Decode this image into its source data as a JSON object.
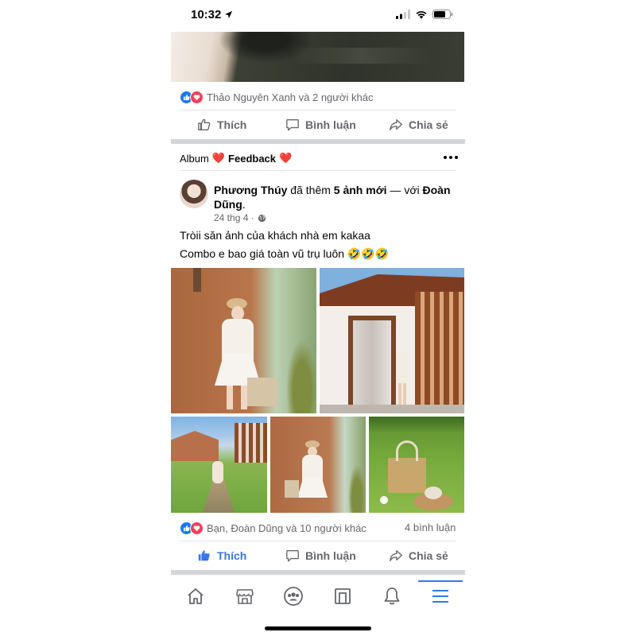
{
  "status_bar": {
    "time": "10:32"
  },
  "post1": {
    "reactions_text": "Thảo Nguyên Xanh và 2 người khác",
    "actions": {
      "like": "Thích",
      "comment": "Bình luận",
      "share": "Chia sẻ"
    }
  },
  "post2": {
    "album_label": "Album",
    "album_emoji_1": "❤️",
    "album_title": "Feedback",
    "album_emoji_2": "❤️",
    "author": "Phương Thúy",
    "header_mid1": " đã thêm ",
    "photos_count": "5 ảnh mới",
    "header_mid2": " — với ",
    "tagged_first": "Đoàn",
    "tagged_second": "Dũng",
    "header_end": ".",
    "date": "24 thg 4 ·",
    "text_line1": "Tròii săn ảnh của khách nhà em kakaa",
    "text_line2": "Combo e bao giá toàn vũ trụ luôn 🤣🤣🤣",
    "reactions_text": "Bạn, Đoàn Dũng và 10 người khác",
    "comments_count": "4 bình luận",
    "actions": {
      "like": "Thích",
      "comment": "Bình luận",
      "share": "Chia sẻ"
    }
  },
  "bottom_nav": [
    "home-icon",
    "marketplace-icon",
    "groups-icon",
    "watch-icon",
    "notifications-icon",
    "menu-icon"
  ],
  "colors": {
    "accent": "#3578e5",
    "muted": "#65676b",
    "divider": "#d3d5d9"
  }
}
